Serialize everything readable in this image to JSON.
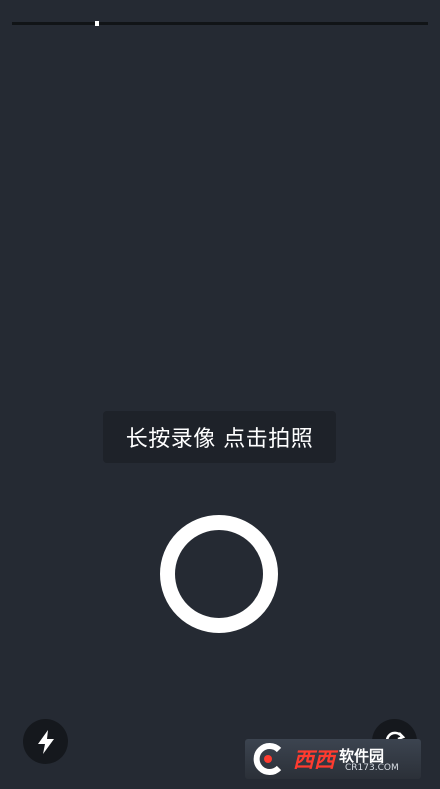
{
  "recording": {
    "progress": 0.2
  },
  "hint": {
    "text": "长按录像 点击拍照"
  },
  "controls": {
    "flash_icon": "flash-icon",
    "switch_icon": "camera-switch-icon",
    "shutter_icon": "shutter-ring"
  },
  "watermark": {
    "logo_text": "C",
    "brand_red": "西西",
    "brand_white": "软件园",
    "url": "CR173.COM"
  },
  "colors": {
    "background": "#252a33",
    "accent": "#ffffff",
    "watermark_red": "#ff3b2f"
  }
}
